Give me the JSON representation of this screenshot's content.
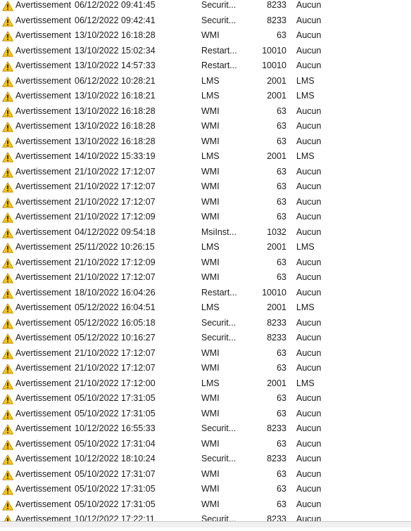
{
  "event_list": {
    "rows": [
      {
        "level": "Avertissement",
        "date": "06/12/2022 09:41:45",
        "source": "Securit...",
        "event_id": "8233",
        "category": "Aucun"
      },
      {
        "level": "Avertissement",
        "date": "06/12/2022 09:42:41",
        "source": "Securit...",
        "event_id": "8233",
        "category": "Aucun"
      },
      {
        "level": "Avertissement",
        "date": "13/10/2022 16:18:28",
        "source": "WMI",
        "event_id": "63",
        "category": "Aucun"
      },
      {
        "level": "Avertissement",
        "date": "13/10/2022 15:02:34",
        "source": "Restart...",
        "event_id": "10010",
        "category": "Aucun"
      },
      {
        "level": "Avertissement",
        "date": "13/10/2022 14:57:33",
        "source": "Restart...",
        "event_id": "10010",
        "category": "Aucun"
      },
      {
        "level": "Avertissement",
        "date": "06/12/2022 10:28:21",
        "source": "LMS",
        "event_id": "2001",
        "category": "LMS"
      },
      {
        "level": "Avertissement",
        "date": "13/10/2022 16:18:21",
        "source": "LMS",
        "event_id": "2001",
        "category": "LMS"
      },
      {
        "level": "Avertissement",
        "date": "13/10/2022 16:18:28",
        "source": "WMI",
        "event_id": "63",
        "category": "Aucun"
      },
      {
        "level": "Avertissement",
        "date": "13/10/2022 16:18:28",
        "source": "WMI",
        "event_id": "63",
        "category": "Aucun"
      },
      {
        "level": "Avertissement",
        "date": "13/10/2022 16:18:28",
        "source": "WMI",
        "event_id": "63",
        "category": "Aucun"
      },
      {
        "level": "Avertissement",
        "date": "14/10/2022 15:33:19",
        "source": "LMS",
        "event_id": "2001",
        "category": "LMS"
      },
      {
        "level": "Avertissement",
        "date": "21/10/2022 17:12:07",
        "source": "WMI",
        "event_id": "63",
        "category": "Aucun"
      },
      {
        "level": "Avertissement",
        "date": "21/10/2022 17:12:07",
        "source": "WMI",
        "event_id": "63",
        "category": "Aucun"
      },
      {
        "level": "Avertissement",
        "date": "21/10/2022 17:12:07",
        "source": "WMI",
        "event_id": "63",
        "category": "Aucun"
      },
      {
        "level": "Avertissement",
        "date": "21/10/2022 17:12:09",
        "source": "WMI",
        "event_id": "63",
        "category": "Aucun"
      },
      {
        "level": "Avertissement",
        "date": "04/12/2022 09:54:18",
        "source": "MsiInst...",
        "event_id": "1032",
        "category": "Aucun"
      },
      {
        "level": "Avertissement",
        "date": "25/11/2022 10:26:15",
        "source": "LMS",
        "event_id": "2001",
        "category": "LMS"
      },
      {
        "level": "Avertissement",
        "date": "21/10/2022 17:12:09",
        "source": "WMI",
        "event_id": "63",
        "category": "Aucun"
      },
      {
        "level": "Avertissement",
        "date": "21/10/2022 17:12:07",
        "source": "WMI",
        "event_id": "63",
        "category": "Aucun"
      },
      {
        "level": "Avertissement",
        "date": "18/10/2022 16:04:26",
        "source": "Restart...",
        "event_id": "10010",
        "category": "Aucun"
      },
      {
        "level": "Avertissement",
        "date": "05/12/2022 16:04:51",
        "source": "LMS",
        "event_id": "2001",
        "category": "LMS"
      },
      {
        "level": "Avertissement",
        "date": "05/12/2022 16:05:18",
        "source": "Securit...",
        "event_id": "8233",
        "category": "Aucun"
      },
      {
        "level": "Avertissement",
        "date": "05/12/2022 10:16:27",
        "source": "Securit...",
        "event_id": "8233",
        "category": "Aucun"
      },
      {
        "level": "Avertissement",
        "date": "21/10/2022 17:12:07",
        "source": "WMI",
        "event_id": "63",
        "category": "Aucun"
      },
      {
        "level": "Avertissement",
        "date": "21/10/2022 17:12:07",
        "source": "WMI",
        "event_id": "63",
        "category": "Aucun"
      },
      {
        "level": "Avertissement",
        "date": "21/10/2022 17:12:00",
        "source": "LMS",
        "event_id": "2001",
        "category": "LMS"
      },
      {
        "level": "Avertissement",
        "date": "05/10/2022 17:31:05",
        "source": "WMI",
        "event_id": "63",
        "category": "Aucun"
      },
      {
        "level": "Avertissement",
        "date": "05/10/2022 17:31:05",
        "source": "WMI",
        "event_id": "63",
        "category": "Aucun"
      },
      {
        "level": "Avertissement",
        "date": "10/12/2022 16:55:33",
        "source": "Securit...",
        "event_id": "8233",
        "category": "Aucun"
      },
      {
        "level": "Avertissement",
        "date": "05/10/2022 17:31:04",
        "source": "WMI",
        "event_id": "63",
        "category": "Aucun"
      },
      {
        "level": "Avertissement",
        "date": "10/12/2022 18:10:24",
        "source": "Securit...",
        "event_id": "8233",
        "category": "Aucun"
      },
      {
        "level": "Avertissement",
        "date": "05/10/2022 17:31:07",
        "source": "WMI",
        "event_id": "63",
        "category": "Aucun"
      },
      {
        "level": "Avertissement",
        "date": "05/10/2022 17:31:05",
        "source": "WMI",
        "event_id": "63",
        "category": "Aucun"
      },
      {
        "level": "Avertissement",
        "date": "05/10/2022 17:31:05",
        "source": "WMI",
        "event_id": "63",
        "category": "Aucun"
      },
      {
        "level": "Avertissement",
        "date": "10/12/2022 17:22:11",
        "source": "Securit...",
        "event_id": "8233",
        "category": "Aucun"
      }
    ]
  },
  "icons": {
    "level": "warning-icon"
  },
  "colors": {
    "warning_fill": "#f5c518",
    "warning_stroke": "#b8860b"
  }
}
